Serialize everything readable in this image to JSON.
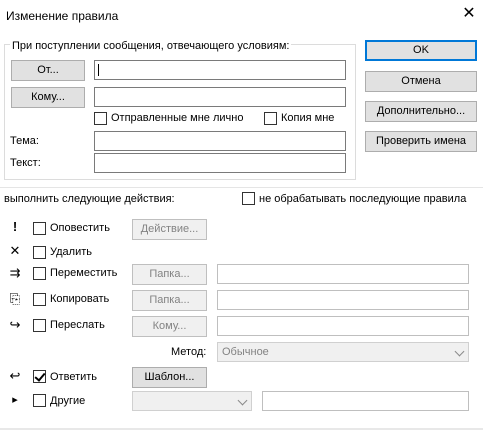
{
  "window": {
    "title": "Изменение правила",
    "close_label": "✕"
  },
  "conditions": {
    "group_label": "При поступлении сообщения, отвечающего условиям:",
    "from_button": "От...",
    "to_button": "Кому...",
    "from_value": "",
    "to_value": "",
    "sent_to_me_label": "Отправленные мне лично",
    "sent_to_me_checked": false,
    "cc_me_label": "Копия мне",
    "cc_me_checked": false,
    "subject_label": "Тема:",
    "subject_value": "",
    "body_label": "Текст:",
    "body_value": ""
  },
  "side_buttons": {
    "ok": "OK",
    "cancel": "Отмена",
    "advanced": "Дополнительно...",
    "check_names": "Проверить имена"
  },
  "actions": {
    "group_label": "выполнить следующие действия:",
    "stop_label": "не обрабатывать последующие правила",
    "stop_checked": false,
    "items": [
      {
        "icon": "!",
        "label": "Оповестить",
        "checked": false,
        "button": "Действие..."
      },
      {
        "icon": "✕",
        "label": "Удалить",
        "checked": false
      },
      {
        "icon": "⇉",
        "label": "Переместить",
        "checked": false,
        "button": "Папка...",
        "value": ""
      },
      {
        "icon": "⎘",
        "label": "Копировать",
        "checked": false,
        "button": "Папка...",
        "value": ""
      },
      {
        "icon": "↪",
        "label": "Переслать",
        "checked": false,
        "button": "Кому...",
        "value": ""
      },
      {
        "icon": "↩",
        "label": "Ответить",
        "checked": true,
        "button": "Шаблон..."
      },
      {
        "icon": "▸",
        "label": "Другие",
        "checked": false,
        "value": ""
      }
    ],
    "method_label": "Метод:",
    "method_value": "Обычное",
    "other_select_value": ""
  }
}
